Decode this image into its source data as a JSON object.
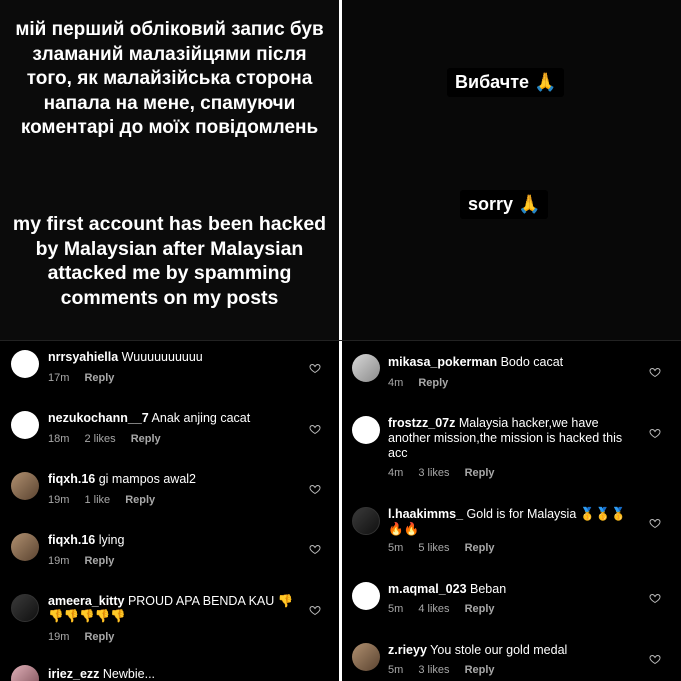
{
  "story_left": {
    "ukrainian_text": "мій перший обліковий запис був зламаний малазійцями після того, як малайзійська сторона напала на мене, спамуючи коментарі до моїх повідомлень",
    "english_text": "my first account has been hacked by Malaysian after Malaysian attacked me by spamming comments on my posts"
  },
  "story_right": {
    "sticker_uk": "Вибачте 🙏",
    "sticker_en": "sorry 🙏"
  },
  "comments_left": [
    {
      "user": "nrrsyahiella",
      "text": "Wuuuuuuuuuu",
      "time": "17m",
      "likes": "",
      "reply": "Reply"
    },
    {
      "user": "nezukochann__7",
      "text": "Anak anjing cacat",
      "time": "18m",
      "likes": "2 likes",
      "reply": "Reply"
    },
    {
      "user": "fiqxh.16",
      "text": "gi mampos awal2",
      "time": "19m",
      "likes": "1 like",
      "reply": "Reply"
    },
    {
      "user": "fiqxh.16",
      "text": "lying",
      "time": "19m",
      "likes": "",
      "reply": "Reply"
    },
    {
      "user": "ameera_kitty",
      "text": "PROUD APA BENDA KAU 👎👎👎👎👎👎",
      "time": "19m",
      "likes": "",
      "reply": "Reply"
    },
    {
      "user": "iriez_ezz",
      "text": "Newbie...",
      "time": "",
      "likes": "",
      "reply": ""
    }
  ],
  "comments_right": [
    {
      "user": "mikasa_pokerman",
      "text": "Bodo cacat",
      "time": "4m",
      "likes": "",
      "reply": "Reply"
    },
    {
      "user": "frostzz_07z",
      "text": "Malaysia hacker,we have another mission,the mission is hacked this acc",
      "time": "4m",
      "likes": "3 likes",
      "reply": "Reply"
    },
    {
      "user": "l.haakimms_",
      "text": "Gold is for Malaysia 🥇🥇🥇🔥🔥",
      "time": "5m",
      "likes": "5 likes",
      "reply": "Reply"
    },
    {
      "user": "m.aqmal_023",
      "text": "Beban",
      "time": "5m",
      "likes": "4 likes",
      "reply": "Reply"
    },
    {
      "user": "z.rieyy",
      "text": "You stole our gold medal",
      "time": "5m",
      "likes": "3 likes",
      "reply": "Reply"
    }
  ],
  "icons": {
    "like": "heart-outline-icon"
  }
}
